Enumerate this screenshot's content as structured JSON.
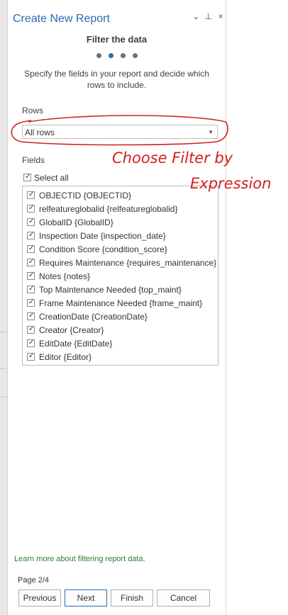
{
  "pane": {
    "title": "Create New Report",
    "controls": [
      "⌄",
      "⊥",
      "×"
    ]
  },
  "step": {
    "title": "Filter the data",
    "dots_total": 4,
    "dots_active": 2,
    "description": "Specify the fields in your report and decide which rows to include."
  },
  "rows": {
    "label": "Rows",
    "selected": "All rows"
  },
  "fields": {
    "label": "Fields",
    "select_all_label": "Select all",
    "items": [
      "OBJECTID {OBJECTID}",
      "relfeatureglobalid {relfeatureglobalid}",
      "GlobalID {GlobalID}",
      "Inspection Date {inspection_date}",
      "Condition Score {condition_score}",
      "Requires Maintenance {requires_maintenance}",
      "Notes {notes}",
      "Top Maintenance Needed {top_maint}",
      "Frame Maintenance Needed {frame_maint}",
      "CreationDate {CreationDate}",
      "Creator {Creator}",
      "EditDate {EditDate}",
      "Editor {Editor}"
    ]
  },
  "footer": {
    "learn_link": "Learn more about filtering report data.",
    "page_indicator": "Page 2/4",
    "buttons": {
      "previous": "Previous",
      "next": "Next",
      "finish": "Finish",
      "cancel": "Cancel"
    }
  },
  "annotation": {
    "line1": "Choose Filter by",
    "line2": "Expression",
    "color": "#d21f1f"
  },
  "colors": {
    "accent": "#2b6bb5",
    "link": "#2e7d32"
  }
}
